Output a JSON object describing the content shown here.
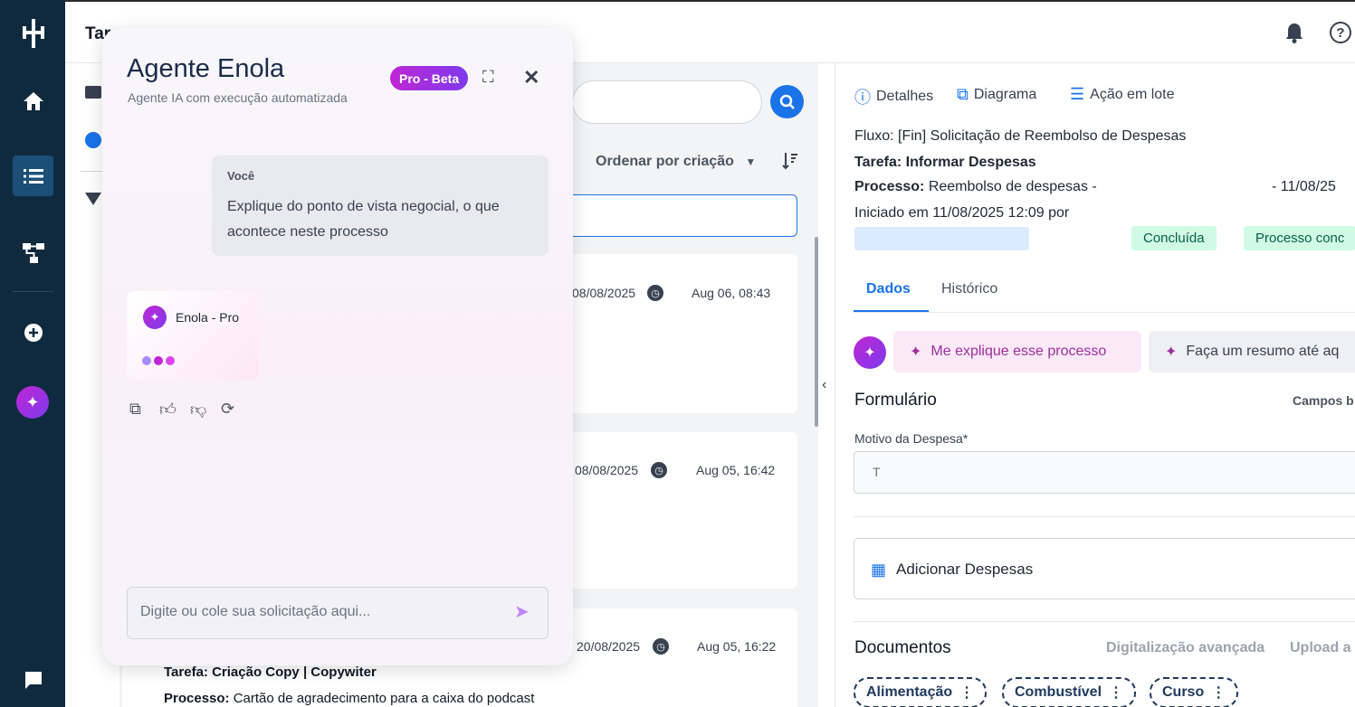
{
  "header": {
    "title": "Tar",
    "notifications_icon": "bell-icon",
    "help_glyph": "?"
  },
  "sidebar": {
    "items": [
      {
        "name": "logo",
        "icon": "logo-icon"
      },
      {
        "name": "home",
        "icon": "home-icon"
      },
      {
        "name": "tasks",
        "icon": "tasks-icon",
        "active": true
      },
      {
        "name": "diagram",
        "icon": "diagram-icon"
      },
      {
        "name": "add",
        "icon": "plus-circle-icon"
      },
      {
        "name": "ai",
        "icon": "sparkle-icon"
      },
      {
        "name": "chat",
        "icon": "chat-icon"
      }
    ]
  },
  "list": {
    "sort_label": "Ordenar por criação",
    "cards": [
      {
        "date": "08/08/2025",
        "time": "Aug 06, 08:43"
      },
      {
        "date": "08/08/2025",
        "time": "Aug 05, 16:42"
      },
      {
        "date": "20/08/2025",
        "time": "Aug 05, 16:22",
        "task_label": "Tarefa:",
        "task_value": "Criação Copy | Copywiter",
        "process_label": "Processo:",
        "process_value": "Cartão de agradecimento para a caixa do podcast"
      }
    ]
  },
  "detail": {
    "tabs": [
      {
        "label": "Detalhes",
        "icon": "info-icon"
      },
      {
        "label": "Diagrama",
        "icon": "diagram-icon"
      },
      {
        "label": "Ação em lote",
        "icon": "layers-icon"
      }
    ],
    "flow_label": "Fluxo:",
    "flow_value": "[Fin] Solicitação de Reembolso de Despesas",
    "task_label": "Tarefa:",
    "task_value": "Informar Despesas",
    "process_label": "Processo:",
    "process_value": "Reembolso de despesas -",
    "process_suffix": "- 11/08/25",
    "started": "Iniciado em 11/08/2025 12:09 por",
    "badges": [
      "Concluída",
      "Processo conc"
    ],
    "data_tabs": [
      "Dados",
      "Histórico"
    ],
    "suggestions": [
      "Me explique esse processo",
      "Faça um resumo até aq"
    ],
    "form_title": "Formulário",
    "form_right": "Campos b",
    "field_label": "Motivo da Despesa*",
    "field_value": "T",
    "add_expenses": "Adicionar Despesas",
    "docs_title": "Documentos",
    "docs_actions": [
      "Digitalização avançada",
      "Upload a"
    ],
    "doc_chips": [
      "Alimentação",
      "Combustível",
      "Curso"
    ]
  },
  "agent": {
    "title": "Agente Enola",
    "subtitle": "Agente IA com execução automatizada",
    "badge": "Pro - Beta",
    "user_label": "Você",
    "user_message": "Explique do ponto de vista negocial, o que acontece neste processo",
    "bot_name": "Enola - Pro",
    "input_placeholder": "Digite ou cole sua solicitação aqui...",
    "colors": {
      "accent_start": "#c026d3",
      "accent_end": "#7c3aed"
    }
  }
}
